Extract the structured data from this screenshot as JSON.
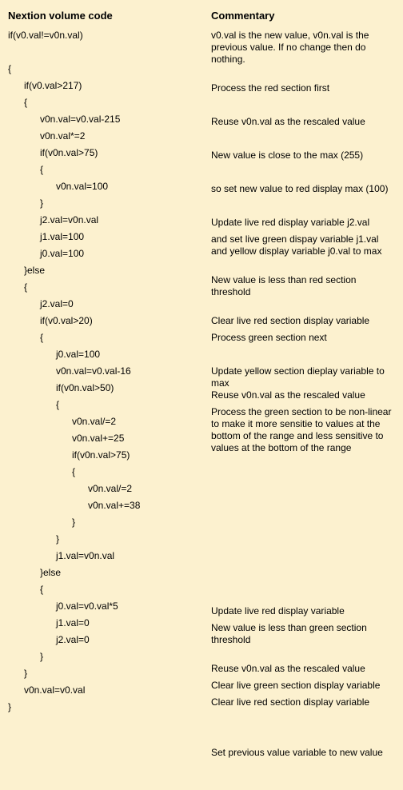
{
  "headers": {
    "code": "Nextion volume code",
    "commentary": "Commentary"
  },
  "rows": [
    {
      "ind": 0,
      "code": "if(v0.val!=v0n.val)",
      "comm": "v0.val is the new value, v0n.val is the previous value. If no change then do nothing.",
      "h": 2
    },
    {
      "ind": 0,
      "code": "{",
      "comm": ""
    },
    {
      "ind": 1,
      "code": "if(v0.val>217)",
      "comm": "Process the red section first"
    },
    {
      "ind": 1,
      "code": "{",
      "comm": ""
    },
    {
      "ind": 2,
      "code": "v0n.val=v0.val-215",
      "comm": "Reuse v0n.val as the rescaled value"
    },
    {
      "ind": 2,
      "code": "v0n.val*=2",
      "comm": ""
    },
    {
      "ind": 2,
      "code": "if(v0n.val>75)",
      "comm": "New value is close to the max (255)"
    },
    {
      "ind": 2,
      "code": "{",
      "comm": ""
    },
    {
      "ind": 3,
      "code": "v0n.val=100",
      "comm": "so set new value to red display max (100)"
    },
    {
      "ind": 2,
      "code": "}",
      "comm": ""
    },
    {
      "ind": 2,
      "code": "j2.val=v0n.val",
      "comm": "Update live red display variable j2.val"
    },
    {
      "ind": 2,
      "code": "j1.val=100",
      "comm": "and set live green dispay variable j1.val and yellow display variable j0.val to max",
      "h": 2,
      "commOverflow": true
    },
    {
      "ind": 2,
      "code": "j0.val=100",
      "comm": ""
    },
    {
      "ind": 1,
      "code": "}else",
      "comm": "New value is less than red section threshold"
    },
    {
      "ind": 1,
      "code": "{",
      "comm": ""
    },
    {
      "ind": 2,
      "code": "j2.val=0",
      "comm": "Clear live red section display variable"
    },
    {
      "ind": 2,
      "code": "if(v0.val>20)",
      "comm": "Process green section next"
    },
    {
      "ind": 2,
      "code": "{",
      "comm": ""
    },
    {
      "ind": 3,
      "code": "j0.val=100",
      "comm": "Update yellow section dieplay variable to max"
    },
    {
      "ind": 3,
      "code": "v0n.val=v0.val-16",
      "comm": "Reuse v0n.val as the rescaled value"
    },
    {
      "ind": 3,
      "code": "if(v0n.val>50)",
      "comm": "Process the green section to be non-linear to make it more sensitie to values at the bottom of the range and less sensitive to values at the bottom of the range",
      "h": 4,
      "commOverflow": true
    },
    {
      "ind": 3,
      "code": "{",
      "comm": ""
    },
    {
      "ind": 4,
      "code": "v0n.val/=2",
      "comm": ""
    },
    {
      "ind": 4,
      "code": "v0n.val+=25",
      "comm": ""
    },
    {
      "ind": 4,
      "code": "if(v0n.val>75)",
      "comm": ""
    },
    {
      "ind": 4,
      "code": "{",
      "comm": ""
    },
    {
      "ind": 5,
      "code": "v0n.val/=2",
      "comm": ""
    },
    {
      "ind": 5,
      "code": "v0n.val+=38",
      "comm": ""
    },
    {
      "ind": 4,
      "code": "}",
      "comm": ""
    },
    {
      "ind": 3,
      "code": "}",
      "comm": ""
    },
    {
      "ind": 3,
      "code": "j1.val=v0n.val",
      "comm": "Update live red display variable"
    },
    {
      "ind": 2,
      "code": "}else",
      "comm": "New value is less than green section threshold"
    },
    {
      "ind": 2,
      "code": "{",
      "comm": ""
    },
    {
      "ind": 3,
      "code": "j0.val=v0.val*5",
      "comm": "Reuse v0n.val as the rescaled value"
    },
    {
      "ind": 3,
      "code": "j1.val=0",
      "comm": "Clear live green section display variable"
    },
    {
      "ind": 3,
      "code": "j2.val=0",
      "comm": "Clear live red section display variable"
    },
    {
      "ind": 2,
      "code": "}",
      "comm": ""
    },
    {
      "ind": 1,
      "code": "}",
      "comm": ""
    },
    {
      "ind": 1,
      "code": "v0n.val=v0.val",
      "comm": "Set previous value variable to new value"
    },
    {
      "ind": 0,
      "code": "}",
      "comm": ""
    }
  ]
}
